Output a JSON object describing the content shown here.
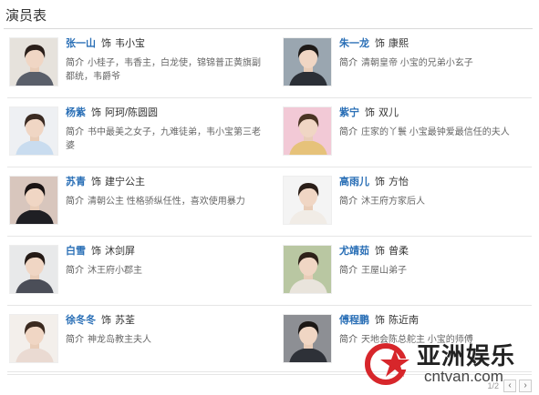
{
  "page": {
    "title": "演员表"
  },
  "labels": {
    "as": "饰",
    "intro": "简介"
  },
  "cast": [
    {
      "actor": "张一山",
      "role": "韦小宝",
      "desc": "小桂子，韦香主，白龙使，锦锦普正黄旗副都统，韦爵爷",
      "photo": "actor-photo-1",
      "hair": "#2a1f1a",
      "top": "#5a5f6a",
      "bg": "#e6e2dc"
    },
    {
      "actor": "朱一龙",
      "role": "康熙",
      "desc": "清朝皇帝 小宝的兄弟小玄子",
      "photo": "actor-photo-2",
      "hair": "#1e1a18",
      "top": "#2b2f36",
      "bg": "#9aa6b0"
    },
    {
      "actor": "杨紫",
      "role": "阿珂/陈圆圆",
      "desc": "书中最美之女子，九难徒弟，韦小宝第三老婆",
      "photo": "actor-photo-3",
      "hair": "#3a2a22",
      "top": "#c9dcef",
      "bg": "#eef0f3"
    },
    {
      "actor": "紫宁",
      "role": "双儿",
      "desc": "庄家的丫鬟 小宝最钟爱最信任的夫人",
      "photo": "actor-photo-4",
      "hair": "#4a3424",
      "top": "#e6c27a",
      "bg": "#f2c9d6"
    },
    {
      "actor": "苏青",
      "role": "建宁公主",
      "desc": "清朝公主 性格骄纵任性，喜欢使用暴力",
      "photo": "actor-photo-5",
      "hair": "#1a1414",
      "top": "#1f1f24",
      "bg": "#d8c6bd"
    },
    {
      "actor": "高雨儿",
      "role": "方怡",
      "desc": "沐王府方家后人",
      "photo": "actor-photo-6",
      "hair": "#2a1e18",
      "top": "#f1ece6",
      "bg": "#f4f4f4"
    },
    {
      "actor": "白雪",
      "role": "沐剑屏",
      "desc": "沐王府小郡主",
      "photo": "actor-photo-7",
      "hair": "#241a16",
      "top": "#4b4e58",
      "bg": "#e8e9ea"
    },
    {
      "actor": "尤靖茹",
      "role": "曾柔",
      "desc": "王屋山弟子",
      "photo": "actor-photo-8",
      "hair": "#2d2119",
      "top": "#e9e4dc",
      "bg": "#b9c7a2"
    },
    {
      "actor": "徐冬冬",
      "role": "苏荃",
      "desc": "神龙岛教主夫人",
      "photo": "actor-photo-9",
      "hair": "#3b2a20",
      "top": "#eadad2",
      "bg": "#f3efeb"
    },
    {
      "actor": "傅程鹏",
      "role": "陈近南",
      "desc": "天地会陈总舵主 小宝的师傅",
      "photo": "actor-photo-10",
      "hair": "#1b1715",
      "top": "#2e3138",
      "bg": "#8d8f94"
    }
  ],
  "pager": {
    "text": "1/2",
    "prev": "‹",
    "next": "›"
  },
  "watermark": {
    "cn": "亚洲娱乐",
    "url": "cntvan.com",
    "red": "#d7262b"
  }
}
